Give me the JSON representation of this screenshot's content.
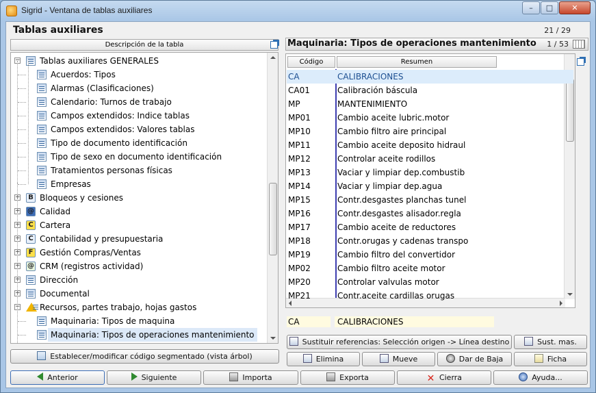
{
  "window": {
    "title": "Sigrid - Ventana de tablas auxiliares",
    "minimize": "–",
    "maximize": "□",
    "close": "✕"
  },
  "heading": "Tablas auxiliares",
  "top_counter": "21 / 29",
  "left": {
    "column_header": "Descripción de la tabla",
    "tree": [
      {
        "label": "Tablas auxiliares GENERALES",
        "level": 0,
        "expander": "−",
        "icon": "folder-grid-icon"
      },
      {
        "label": "Acuerdos: Tipos",
        "level": 1,
        "icon": "table-icon"
      },
      {
        "label": "Alarmas (Clasificaciones)",
        "level": 1,
        "icon": "table-icon"
      },
      {
        "label": "Calendario: Turnos de trabajo",
        "level": 1,
        "icon": "table-icon"
      },
      {
        "label": "Campos extendidos: Indice tablas",
        "level": 1,
        "icon": "table-icon"
      },
      {
        "label": "Campos extendidos: Valores tablas",
        "level": 1,
        "icon": "table-icon"
      },
      {
        "label": "Tipo de documento identificación",
        "level": 1,
        "icon": "table-icon"
      },
      {
        "label": "Tipo de sexo en documento identificación",
        "level": 1,
        "icon": "table-icon"
      },
      {
        "label": "Tratamientos personas físicas",
        "level": 1,
        "icon": "table-icon"
      },
      {
        "label": "Empresas",
        "level": 1,
        "icon": "table-icon"
      },
      {
        "label": "Bloqueos y cesiones",
        "level": 0,
        "expander": "+",
        "icon": "bloqueos-icon",
        "glyph": "B"
      },
      {
        "label": "Calidad",
        "level": 0,
        "expander": "+",
        "icon": "calidad-icon",
        "glyph": "@"
      },
      {
        "label": "Cartera",
        "level": 0,
        "expander": "+",
        "icon": "cartera-icon",
        "glyph": "C"
      },
      {
        "label": "Contabilidad y presupuestaria",
        "level": 0,
        "expander": "+",
        "icon": "contabilidad-icon",
        "glyph": "C"
      },
      {
        "label": "Gestión Compras/Ventas",
        "level": 0,
        "expander": "+",
        "icon": "compras-ventas-icon",
        "glyph": "F"
      },
      {
        "label": "CRM (registros actividad)",
        "level": 0,
        "expander": "+",
        "icon": "crm-icon",
        "glyph": "@"
      },
      {
        "label": "Dirección",
        "level": 0,
        "expander": "+",
        "icon": "direccion-icon"
      },
      {
        "label": "Documental",
        "level": 0,
        "expander": "+",
        "icon": "documental-icon"
      },
      {
        "label": "Recursos, partes trabajo, hojas gastos",
        "level": 0,
        "expander": "−",
        "icon": "recursos-warning-icon"
      },
      {
        "label": "Maquinaria: Tipos de maquina",
        "level": 1,
        "icon": "table-icon"
      },
      {
        "label": "Maquinaria: Tipos de operaciones mantenimiento",
        "level": 1,
        "icon": "table-icon",
        "selected": true
      }
    ],
    "segment_button": "Establecer/modificar código segmentado (vista árbol)"
  },
  "right": {
    "title": "Maquinaria: Tipos de operaciones mantenimiento",
    "counter": "1 / 53",
    "col_code": "Código",
    "col_summary": "Resumen",
    "rows": [
      {
        "code": "CA",
        "summary": "CALIBRACIONES",
        "selected": true
      },
      {
        "code": "CA01",
        "summary": "Calibración báscula"
      },
      {
        "code": "MP",
        "summary": "MANTENIMIENTO"
      },
      {
        "code": "MP01",
        "summary": "Cambio aceite lubric.motor"
      },
      {
        "code": "MP10",
        "summary": "Cambio filtro aire principal"
      },
      {
        "code": "MP11",
        "summary": "Cambio aceite deposito hidraul"
      },
      {
        "code": "MP12",
        "summary": "Controlar aceite rodillos"
      },
      {
        "code": "MP13",
        "summary": "Vaciar y limpiar dep.combustib"
      },
      {
        "code": "MP14",
        "summary": "Vaciar y limpiar dep.agua"
      },
      {
        "code": "MP15",
        "summary": "Contr.desgastes planchas tunel"
      },
      {
        "code": "MP16",
        "summary": "Contr.desgastes alisador.regla"
      },
      {
        "code": "MP17",
        "summary": "Cambio aceite de reductores"
      },
      {
        "code": "MP18",
        "summary": "Contr.orugas y cadenas transpo"
      },
      {
        "code": "MP19",
        "summary": "Cambio filtro del convertidor"
      },
      {
        "code": "MP02",
        "summary": "Cambio filtro aceite motor"
      },
      {
        "code": "MP20",
        "summary": "Controlar valvulas motor"
      },
      {
        "code": "MP21",
        "summary": "Contr.aceite cardillas orugas"
      }
    ],
    "detail_code": "CA",
    "detail_summary": "CALIBRACIONES",
    "buttons": {
      "replace_refs": "Sustituir referencias: Selección origen -> Línea destino",
      "replace_more": "Sust. mas.",
      "delete": "Elimina",
      "move": "Mueve",
      "deactivate": "Dar de Baja",
      "record": "Ficha"
    }
  },
  "bottom": {
    "previous": "Anterior",
    "next": "Siguiente",
    "import": "Importa",
    "export": "Exporta",
    "close": "Cierra",
    "help": "Ayuda..."
  },
  "colors": {
    "selection": "#dcecfb",
    "detail_bg": "#fffbe0",
    "column_divider": "#3d3db0",
    "close_red": "#d9261c",
    "arrow_green": "#2f8a2f"
  }
}
